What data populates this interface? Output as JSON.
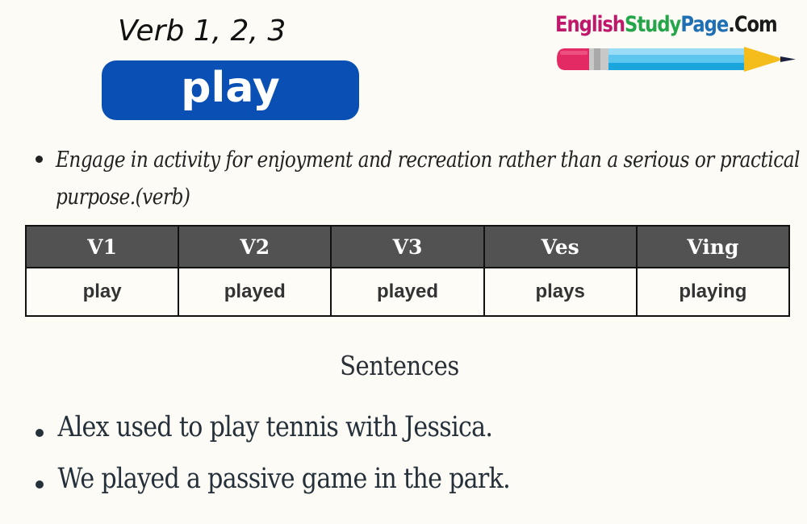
{
  "header": {
    "subtitle": "Verb 1, 2, 3",
    "word": "play"
  },
  "logo": {
    "parts": [
      "English",
      "Study",
      "Page",
      ".Com"
    ],
    "colors": {
      "english": "#c0176a",
      "study": "#25a54a",
      "page": "#1f6fb5",
      "com": "#1a1a1a"
    },
    "icon": "pencil-icon"
  },
  "definition": {
    "text": "Engage in activity for enjoyment and recreation rather than a serious or practical purpose.(verb)"
  },
  "verb_table": {
    "headers": [
      "V1",
      "V2",
      "V3",
      "Ves",
      "Ving"
    ],
    "values": [
      "play",
      "played",
      "played",
      "plays",
      "playing"
    ]
  },
  "sentences": {
    "heading": "Sentences",
    "items": [
      "Alex used to play tennis with Jessica.",
      "We played a passive game in the park."
    ]
  },
  "colors": {
    "background": "#fcfbf5",
    "badge": "#0a4fb4",
    "table_header": "#525252"
  }
}
